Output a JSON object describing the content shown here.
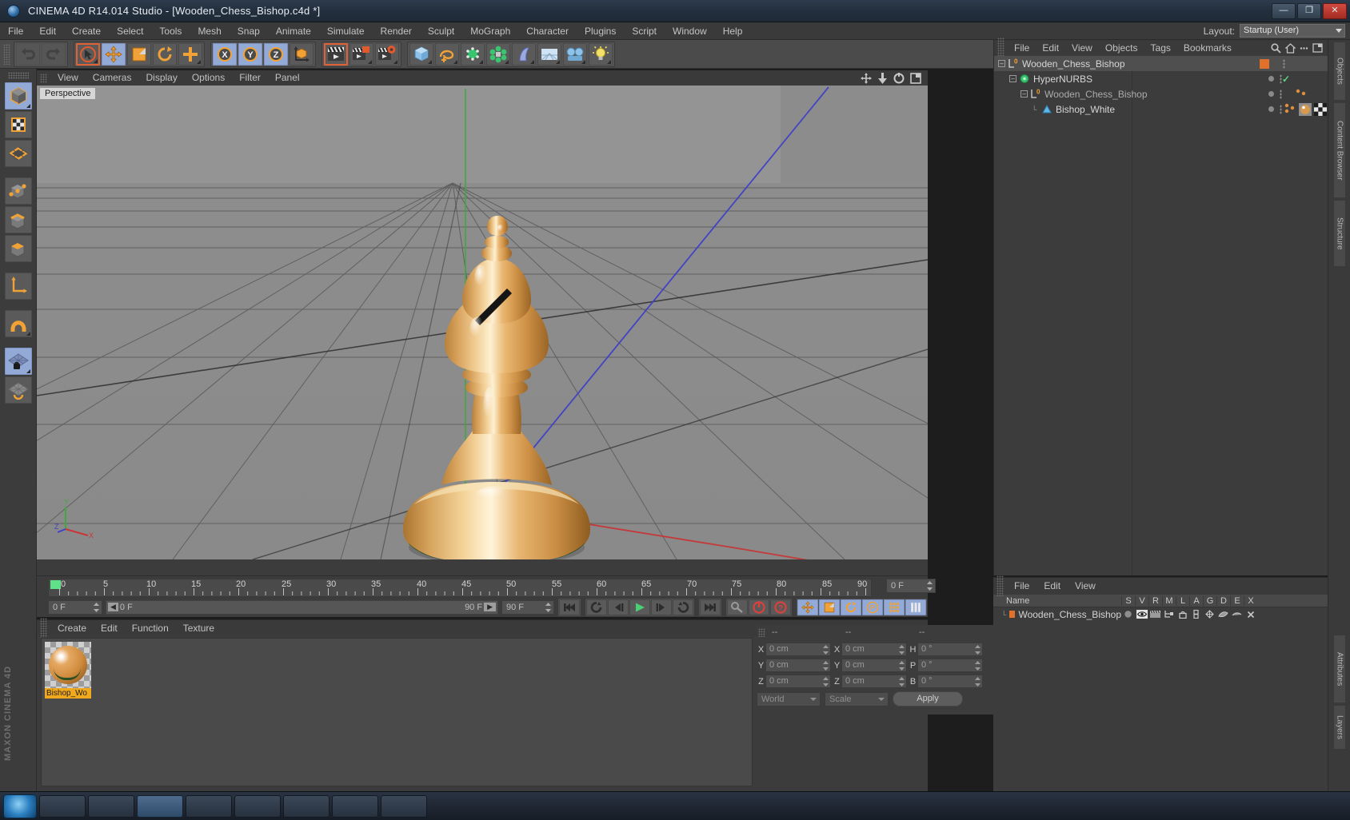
{
  "window": {
    "title": "CINEMA 4D R14.014 Studio - [Wooden_Chess_Bishop.c4d *]",
    "minimize_label": "—",
    "maximize_label": "❐",
    "close_label": "✕"
  },
  "menubar": {
    "items": [
      "File",
      "Edit",
      "Create",
      "Select",
      "Tools",
      "Mesh",
      "Snap",
      "Animate",
      "Simulate",
      "Render",
      "Sculpt",
      "MoGraph",
      "Character",
      "Plugins",
      "Script",
      "Window",
      "Help"
    ],
    "layout_label": "Layout:",
    "layout_value": "Startup (User)"
  },
  "toolbar": {
    "buttons": [
      {
        "name": "undo-button",
        "icon": "undo-icon",
        "state": "dim"
      },
      {
        "name": "redo-button",
        "icon": "redo-icon",
        "state": "dim"
      },
      {
        "name": "live-selection-button",
        "icon": "cursor-select-icon",
        "state": "selected"
      },
      {
        "name": "move-button",
        "icon": "move-arrows-icon",
        "state": "on"
      },
      {
        "name": "scale-button",
        "icon": "scale-icon",
        "state": "normal"
      },
      {
        "name": "rotate-button",
        "icon": "rotate-icon",
        "state": "normal"
      },
      {
        "name": "world-object-axis-button",
        "icon": "plus-axis-icon",
        "state": "normal"
      },
      {
        "name": "lock-x-axis-button",
        "icon": "axis-x-icon",
        "state": "on"
      },
      {
        "name": "lock-y-axis-button",
        "icon": "axis-y-icon",
        "state": "on"
      },
      {
        "name": "lock-z-axis-button",
        "icon": "axis-z-icon",
        "state": "on"
      },
      {
        "name": "world-coordinate-button",
        "icon": "world-axis-icon",
        "state": "normal"
      },
      {
        "name": "render-view-button",
        "icon": "clapperboard-icon",
        "state": "selected"
      },
      {
        "name": "render-region-button",
        "icon": "clapperboard-region-icon",
        "state": "normal"
      },
      {
        "name": "render-settings-button",
        "icon": "clapperboard-gear-icon",
        "state": "normal"
      },
      {
        "name": "add-cube-button",
        "icon": "cube-icon",
        "state": "normal"
      },
      {
        "name": "add-spline-button",
        "icon": "spline-icon",
        "state": "normal"
      },
      {
        "name": "add-nurbs-button",
        "icon": "hypernurbs-icon",
        "state": "normal"
      },
      {
        "name": "add-array-button",
        "icon": "array-icon",
        "state": "normal"
      },
      {
        "name": "add-deformer-button",
        "icon": "bend-deformer-icon",
        "state": "normal"
      },
      {
        "name": "add-environment-button",
        "icon": "floor-environment-icon",
        "state": "normal"
      },
      {
        "name": "add-camera-button",
        "icon": "camera-icon",
        "state": "normal"
      },
      {
        "name": "add-light-button",
        "icon": "light-bulb-icon",
        "state": "normal"
      }
    ]
  },
  "left_palette": {
    "buttons": [
      {
        "name": "model-mode-button",
        "icon": "model-cube-icon",
        "state": "on"
      },
      {
        "name": "texture-mode-button",
        "icon": "texture-checker-icon",
        "state": "normal"
      },
      {
        "name": "points-mode-button",
        "icon": "points-grid-icon",
        "state": "normal"
      },
      {
        "name": "edit-points-button",
        "icon": "vertex-cube-icon",
        "state": "normal"
      },
      {
        "name": "edit-edges-button",
        "icon": "edge-cube-icon",
        "state": "normal"
      },
      {
        "name": "edit-polygons-button",
        "icon": "polygon-cube-icon",
        "state": "normal"
      },
      {
        "name": "enable-axis-button",
        "icon": "axis-l-icon",
        "state": "normal"
      },
      {
        "name": "enable-snap-button",
        "icon": "magnet-icon",
        "state": "normal"
      },
      {
        "name": "workplane-lock-button",
        "icon": "workplane-lock-icon",
        "state": "on"
      },
      {
        "name": "workplane-button",
        "icon": "workplane-icon",
        "state": "normal"
      }
    ],
    "brand": "MAXON CINEMA 4D"
  },
  "viewport": {
    "menu_items": [
      "View",
      "Cameras",
      "Display",
      "Options",
      "Filter",
      "Panel"
    ],
    "label": "Perspective",
    "axis_labels": [
      "Y",
      "Z",
      "X"
    ],
    "corner_icons": [
      "move-view-icon",
      "dolly-view-icon",
      "rotate-view-icon",
      "maximize-view-icon"
    ]
  },
  "timeline": {
    "tick_labels": [
      "0",
      "5",
      "10",
      "15",
      "20",
      "25",
      "30",
      "35",
      "40",
      "45",
      "50",
      "55",
      "60",
      "65",
      "70",
      "75",
      "80",
      "85",
      "90"
    ],
    "current_frame_field": "0 F",
    "end_frame_field": "90 F",
    "scrub_start": "0 F",
    "scrub_end": "90 F",
    "preview_min": "0 F",
    "preview_max": "90 F",
    "transport": [
      {
        "name": "go-to-start-button",
        "icon": "skip-start-icon"
      },
      {
        "name": "play-backwards-loop-button",
        "icon": "loop-icon"
      },
      {
        "name": "step-back-button",
        "icon": "step-back-icon"
      },
      {
        "name": "play-button",
        "icon": "play-icon"
      },
      {
        "name": "step-forward-button",
        "icon": "step-forward-icon"
      },
      {
        "name": "play-forward-loop-button",
        "icon": "loop-forward-icon"
      },
      {
        "name": "go-to-end-button",
        "icon": "skip-end-icon"
      }
    ],
    "record_tools": [
      {
        "name": "autokeying-button",
        "icon": "key-icon"
      },
      {
        "name": "record-active-objects-button",
        "icon": "record-circle-icon"
      },
      {
        "name": "record-help-button",
        "icon": "question-mark-icon"
      }
    ],
    "key_toggles": [
      {
        "name": "key-position-button",
        "icon": "move-arrows-icon"
      },
      {
        "name": "key-scale-button",
        "icon": "scale-icon"
      },
      {
        "name": "key-rotation-button",
        "icon": "rotate-icon"
      },
      {
        "name": "key-parameter-button",
        "icon": "parameter-p-icon"
      },
      {
        "name": "key-point-level-button",
        "icon": "points-icon"
      },
      {
        "name": "key-all-button",
        "icon": "bars-icon"
      }
    ]
  },
  "material_manager": {
    "menu_items": [
      "Create",
      "Edit",
      "Function",
      "Texture"
    ],
    "materials": [
      {
        "name": "Bishop_White",
        "display_name": "Bishop_Wo"
      }
    ]
  },
  "coordinates": {
    "column_headers": [
      "--",
      "--",
      "--"
    ],
    "rows": [
      {
        "axis1": "X",
        "pos": "0 cm",
        "axis2": "X",
        "size": "0 cm",
        "axis3": "H",
        "rot": "0 °"
      },
      {
        "axis1": "Y",
        "pos": "0 cm",
        "axis2": "Y",
        "size": "0 cm",
        "axis3": "P",
        "rot": "0 °"
      },
      {
        "axis1": "Z",
        "pos": "0 cm",
        "axis2": "Z",
        "size": "0 cm",
        "axis3": "B",
        "rot": "0 °"
      }
    ],
    "system_select": "World",
    "mode_select": "Scale",
    "apply_label": "Apply"
  },
  "object_manager": {
    "menu_items": [
      "File",
      "Edit",
      "View",
      "Objects",
      "Tags",
      "Bookmarks"
    ],
    "tools": [
      "search-icon",
      "home-icon",
      "ellipsis-icon",
      "panel-icon"
    ],
    "rows": [
      {
        "name": "Wooden_Chess_Bishop",
        "icon": "null-object-icon",
        "depth": 0,
        "selected": true,
        "layer_color": "#e0712a",
        "dot": true,
        "vdots": true,
        "check": false,
        "tags": []
      },
      {
        "name": "HyperNURBS",
        "icon": "hypernurbs-icon",
        "depth": 1,
        "selected": false,
        "layer_color": "",
        "dot": true,
        "vdots": true,
        "check": true,
        "tags": []
      },
      {
        "name": "Wooden_Chess_Bishop",
        "icon": "null-object-icon",
        "depth": 2,
        "selected": false,
        "layer_color": "",
        "dot": true,
        "vdots": true,
        "check": false,
        "tags": [
          "dots"
        ]
      },
      {
        "name": "Bishop_White",
        "icon": "polygon-object-icon",
        "depth": 3,
        "selected": false,
        "layer_color": "",
        "dot": true,
        "vdots": true,
        "check": false,
        "tags": [
          "dots",
          "material-tag",
          "uv-tag"
        ]
      }
    ]
  },
  "layer_manager": {
    "menu_items": [
      "File",
      "Edit",
      "View"
    ],
    "name_header": "Name",
    "column_headers": [
      "S",
      "V",
      "R",
      "M",
      "L",
      "A",
      "G",
      "D",
      "E",
      "X"
    ],
    "rows": [
      {
        "name": "Wooden_Chess_Bishop",
        "color": "#e0712a",
        "cells": [
          "solo-dot-icon",
          "eye-icon",
          "render-icon",
          "manager-icon",
          "lock-icon",
          "animate-icon",
          "generator-icon",
          "deformer-icon",
          "expression-icon",
          "xref-icon"
        ]
      }
    ]
  },
  "vertical_tabs": [
    "Objects",
    "Content Browser",
    "Structure",
    "Attributes",
    "Layers"
  ],
  "taskbar": {
    "items": [
      "window-1",
      "window-2",
      "window-3",
      "window-4",
      "window-5",
      "window-6",
      "window-7",
      "window-8"
    ]
  }
}
